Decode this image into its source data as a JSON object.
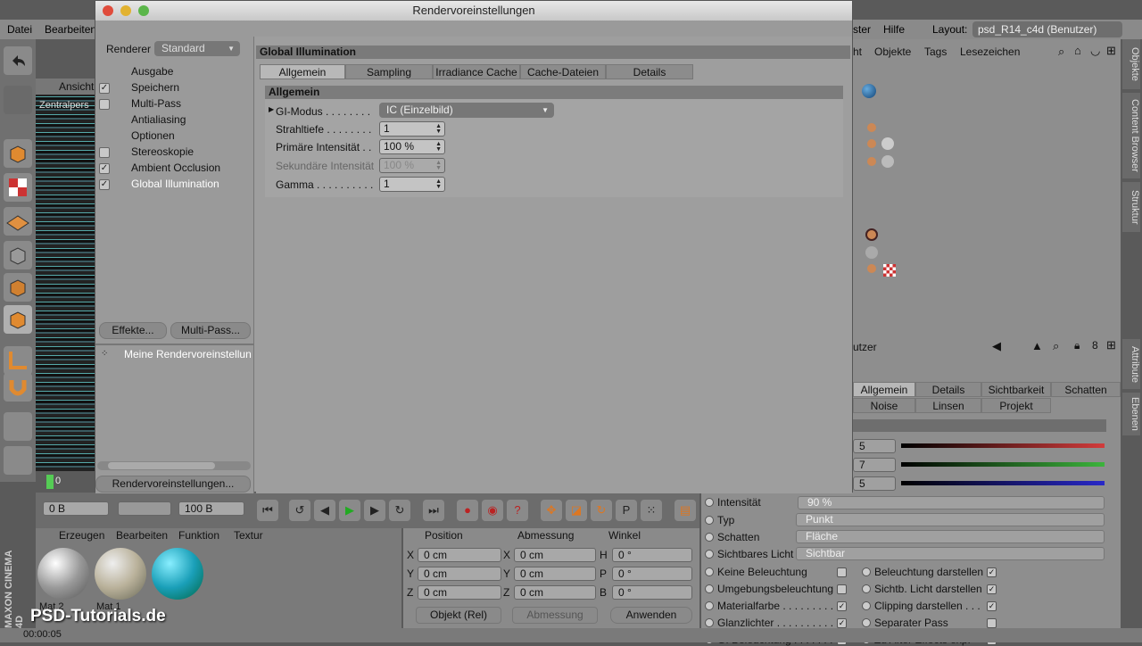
{
  "window": {
    "title": "Rendervoreinstellungen",
    "renderer_label": "Renderer",
    "renderer_value": "Standard",
    "nav_items": [
      {
        "label": "Ausgabe",
        "checkbox": false,
        "checked": false,
        "active": false
      },
      {
        "label": "Speichern",
        "checkbox": true,
        "checked": true,
        "active": false
      },
      {
        "label": "Multi-Pass",
        "checkbox": true,
        "checked": false,
        "active": false
      },
      {
        "label": "Antialiasing",
        "checkbox": false,
        "checked": false,
        "active": false
      },
      {
        "label": "Optionen",
        "checkbox": false,
        "checked": false,
        "active": false
      },
      {
        "label": "Stereoskopie",
        "checkbox": true,
        "checked": false,
        "active": false
      },
      {
        "label": "Ambient Occlusion",
        "checkbox": true,
        "checked": true,
        "active": false
      },
      {
        "label": "Global Illumination",
        "checkbox": true,
        "checked": true,
        "active": true
      }
    ],
    "effekte_button": "Effekte...",
    "multipass_button": "Multi-Pass...",
    "preset_item": "Meine Rendervoreinstellun",
    "rendervoreinstellungen_button": "Rendervoreinstellungen...",
    "panel_title": "Global Illumination",
    "tabs": [
      "Allgemein",
      "Sampling",
      "Irradiance Cache",
      "Cache-Dateien",
      "Details"
    ],
    "section_title": "Allgemein",
    "gi_modus_label": "GI-Modus . . . . . . . .",
    "gi_modus_value": "IC (Einzelbild)",
    "strahltiefe_label": "Strahltiefe . . . . . . . .",
    "strahltiefe_value": "1",
    "primaere_label": "Primäre Intensität . .",
    "primaere_value": "100 %",
    "sekundaere_label": "Sekundäre Intensität",
    "sekundaere_value": "100 %",
    "gamma_label": "Gamma . . . . . . . . . .",
    "gamma_value": "1"
  },
  "menubar": {
    "datei": "Datei",
    "bearbeiten": "Bearbeiten",
    "ster": "ster",
    "hilfe": "Hilfe",
    "layout_label": "Layout:",
    "layout_value": "psd_R14_c4d (Benutzer)"
  },
  "viewport": {
    "ansicht": "Ansicht",
    "zentralpers": "Zentralpers"
  },
  "objects_panel": {
    "menu": [
      "ht",
      "Objekte",
      "Tags",
      "Lesezeichen"
    ],
    "side_tabs": [
      "Objekte",
      "Content Browser",
      "Struktur"
    ]
  },
  "attributes_panel": {
    "header": "utzer",
    "side_tabs": [
      "Attribute",
      "Ebenen"
    ],
    "tabs_row1": [
      "Allgemein",
      "Details",
      "Sichtbarkeit",
      "Schatten"
    ],
    "tabs_row2": [
      "Noise",
      "Linsen",
      "Projekt"
    ],
    "color_fields": [
      "5",
      "7",
      "5"
    ],
    "intensitaet_label": "Intensität",
    "intensitaet_value": "90 %",
    "typ_label": "Typ",
    "typ_value": "Punkt",
    "schatten_label": "Schatten",
    "schatten_value": "Fläche",
    "sichtbares_label": "Sichtbares Licht",
    "sichtbares_value": "Sichtbar",
    "options_left": [
      {
        "label": "Keine Beleuchtung",
        "checked": false
      },
      {
        "label": "Umgebungsbeleuchtung",
        "checked": false
      },
      {
        "label": "Materialfarbe . . . . . . . . .",
        "checked": true
      },
      {
        "label": "Glanzlichter . . . . . . . . . .",
        "checked": true
      },
      {
        "label": "GI Beleuchtung . . . . . . .",
        "checked": true
      }
    ],
    "options_right": [
      {
        "label": "Beleuchtung darstellen",
        "checked": true
      },
      {
        "label": "Sichtb. Licht darstellen",
        "checked": true
      },
      {
        "label": "Clipping darstellen . . .",
        "checked": true
      },
      {
        "label": "Separater Pass",
        "checked": false
      },
      {
        "label": "Zu After Effects exp.",
        "checked": true
      }
    ]
  },
  "timeline": {
    "frame_zero": "0",
    "start": "0 B",
    "end": "100 B"
  },
  "materials": {
    "menu": [
      "Erzeugen",
      "Bearbeiten",
      "Funktion",
      "Textur"
    ],
    "names": [
      "Mat.2",
      "Mat.1",
      ""
    ]
  },
  "coordinates": {
    "headers": [
      "Position",
      "Abmessung",
      "Winkel"
    ],
    "rows": [
      {
        "a": "X",
        "pos": "0 cm",
        "b": "X",
        "size": "0 cm",
        "c": "H",
        "rot": "0 °"
      },
      {
        "a": "Y",
        "pos": "0 cm",
        "b": "Y",
        "size": "0 cm",
        "c": "P",
        "rot": "0 °"
      },
      {
        "a": "Z",
        "pos": "0 cm",
        "b": "Z",
        "size": "0 cm",
        "c": "B",
        "rot": "0 °"
      }
    ],
    "objekt_dropdown": "Objekt (Rel)",
    "abmessung_dropdown": "Abmessung",
    "anwenden_button": "Anwenden"
  },
  "status": {
    "time": "00:00:05",
    "watermark": "PSD-Tutorials.de",
    "maxon": "MAXON CINEMA 4D"
  },
  "colors": {
    "accent_red": "#d23c3c",
    "accent_green": "#3cb43c",
    "accent_blue": "#2828c8",
    "highlight": "#4a8ad8"
  }
}
